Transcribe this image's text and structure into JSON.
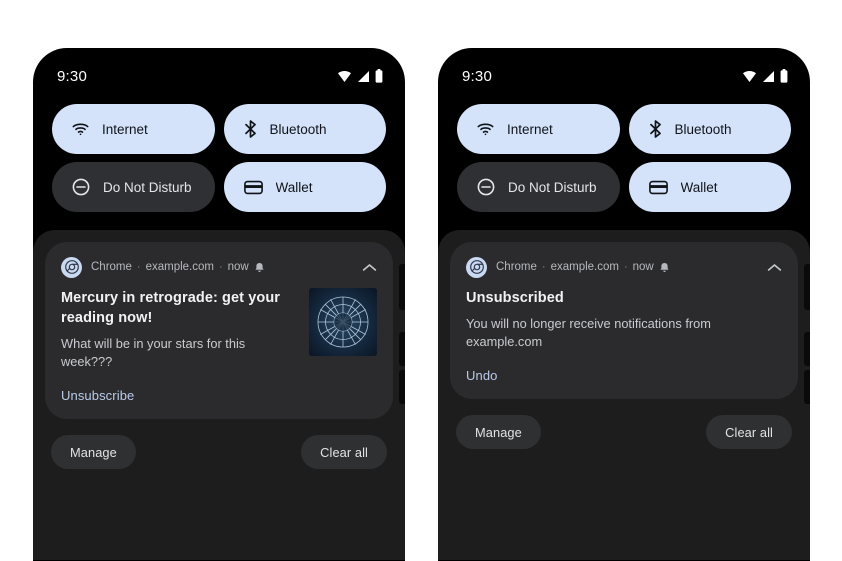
{
  "page": {
    "background": "#ffffff",
    "accent_tile_on": "#d4e3f9",
    "accent_tile_off": "#2f3034",
    "notification_bg": "#2b2b2e",
    "shade_bg": "#1d1d1d",
    "link_color": "#b9cbe8"
  },
  "phones": [
    {
      "id": "before",
      "statusbar": {
        "time": "9:30",
        "icons": [
          "wifi-icon",
          "cell-signal-icon",
          "battery-icon"
        ]
      },
      "quick_settings": [
        {
          "label": "Internet",
          "icon": "wifi-icon",
          "state": "on"
        },
        {
          "label": "Bluetooth",
          "icon": "bluetooth-icon",
          "state": "on"
        },
        {
          "label": "Do Not Disturb",
          "icon": "do-not-disturb-icon",
          "state": "off"
        },
        {
          "label": "Wallet",
          "icon": "wallet-icon",
          "state": "on"
        }
      ],
      "notification": {
        "app": "Chrome",
        "source": "example.com",
        "time": "now",
        "separator": "·",
        "alert_icon": "bell-icon",
        "collapse_icon": "chevron-up-icon",
        "title": "Mercury in retrograde: get your reading now!",
        "body": "What will be in your stars for this week???",
        "action": "Unsubscribe",
        "thumbnail": "zodiac-wheel-image",
        "has_thumbnail": true
      },
      "footer": {
        "manage": "Manage",
        "clear_all": "Clear all"
      }
    },
    {
      "id": "after",
      "statusbar": {
        "time": "9:30",
        "icons": [
          "wifi-icon",
          "cell-signal-icon",
          "battery-icon"
        ]
      },
      "quick_settings": [
        {
          "label": "Internet",
          "icon": "wifi-icon",
          "state": "on"
        },
        {
          "label": "Bluetooth",
          "icon": "bluetooth-icon",
          "state": "on"
        },
        {
          "label": "Do Not Disturb",
          "icon": "do-not-disturb-icon",
          "state": "off"
        },
        {
          "label": "Wallet",
          "icon": "wallet-icon",
          "state": "on"
        }
      ],
      "notification": {
        "app": "Chrome",
        "source": "example.com",
        "time": "now",
        "separator": "·",
        "alert_icon": "bell-icon",
        "collapse_icon": "chevron-up-icon",
        "title": "Unsubscribed",
        "body": "You will no longer receive notifications from example.com",
        "action": "Undo",
        "thumbnail": null,
        "has_thumbnail": false
      },
      "footer": {
        "manage": "Manage",
        "clear_all": "Clear all"
      }
    }
  ]
}
